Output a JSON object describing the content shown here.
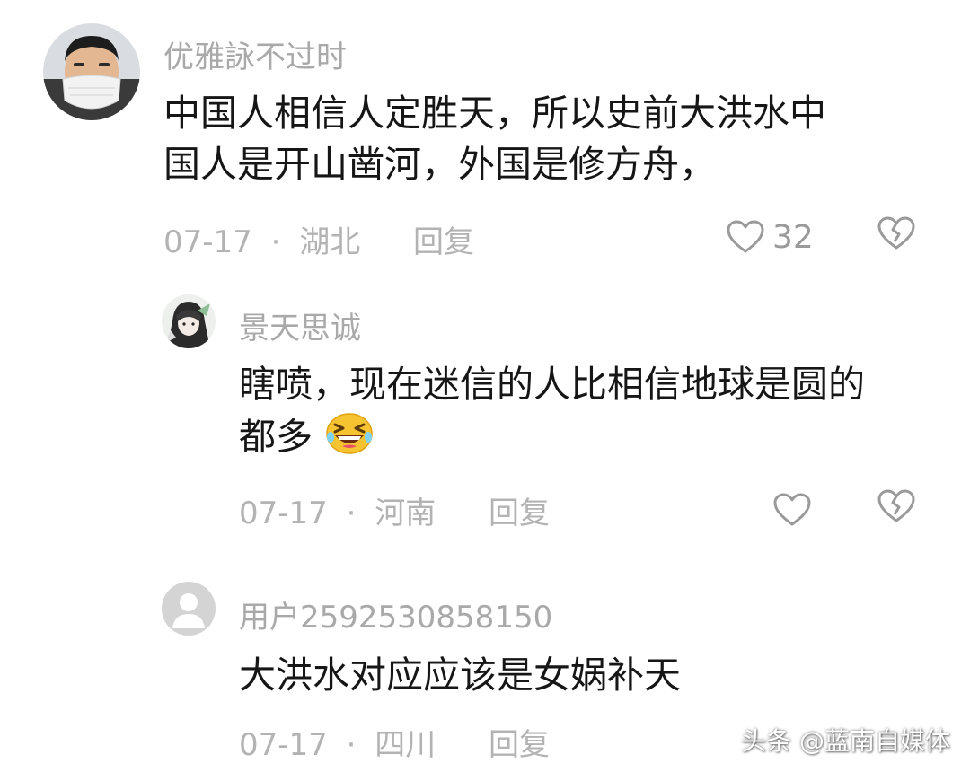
{
  "colors": {
    "username": "#a9a9a9",
    "content": "#161616",
    "meta": "#b3b3b3",
    "icon": "#9a9a9a"
  },
  "comments": [
    {
      "username": "优雅詠不过时",
      "content_lines": [
        "中国人相信人定胜天，所以史前大洪水中",
        "国人是开山凿河，外国是修方舟，"
      ],
      "date": "07-17",
      "separator": "·",
      "location": "湖北",
      "reply_label": "回复",
      "like_count": "32",
      "avatar_icon": "masked-man-avatar"
    },
    {
      "username": "景天思诚",
      "content_lines": [
        "瞎喷，现在迷信的人比相信地球是圆的",
        "都多"
      ],
      "emoji": "laughing-face-emoji",
      "date": "07-17",
      "separator": "·",
      "location": "河南",
      "reply_label": "回复",
      "avatar_icon": "anime-character-avatar"
    },
    {
      "username": "用户2592530858150",
      "content_lines": [
        "大洪水对应应该是女娲补天"
      ],
      "date": "07-17",
      "separator": "·",
      "location": "四川",
      "reply_label": "回复",
      "avatar_icon": "default-user-avatar"
    }
  ],
  "watermark": "头条 @蓝南自媒体"
}
